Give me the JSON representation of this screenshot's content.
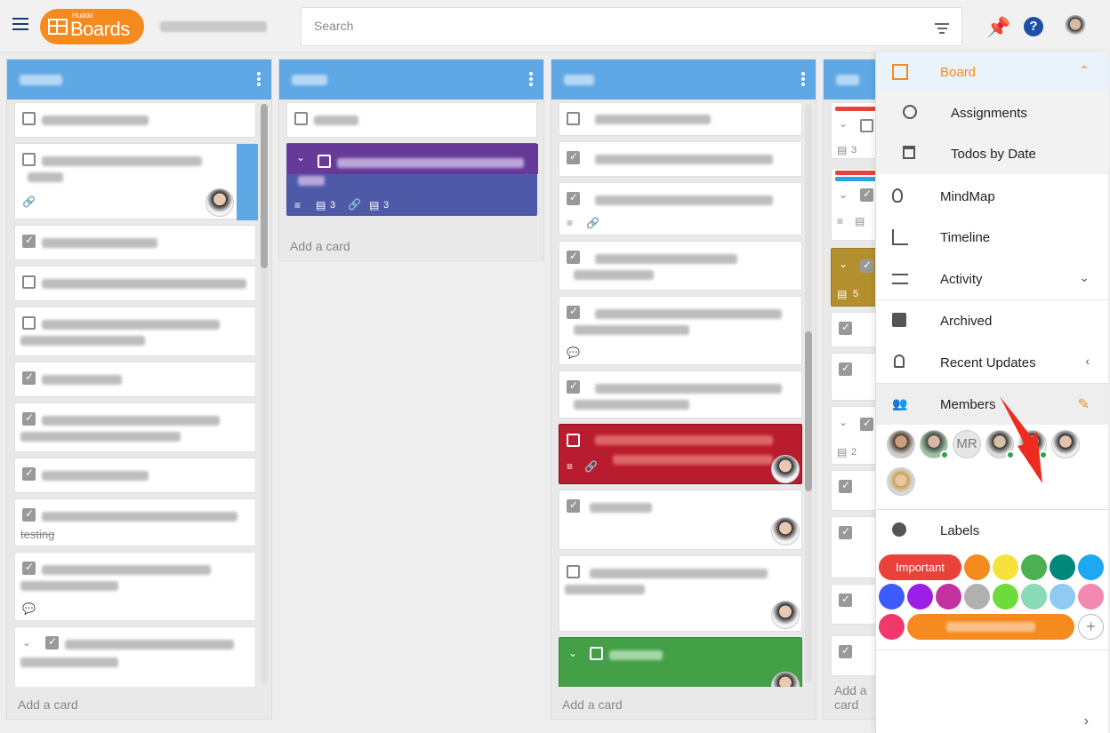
{
  "header": {
    "logo_small": "Huddo",
    "logo_text": "Boards",
    "search_placeholder": "Search"
  },
  "columns": [
    {
      "add_card": "Add a card",
      "card_extra_text": "testing"
    },
    {
      "add_card": "Add a card",
      "card_counts": [
        "3",
        "3"
      ]
    },
    {
      "add_card": "Add a card"
    },
    {
      "add_card": "Add a card",
      "card_counts": [
        "3",
        "5",
        "2"
      ]
    }
  ],
  "panel": {
    "items": [
      {
        "label": "Board"
      },
      {
        "label": "Assignments"
      },
      {
        "label": "Todos by Date"
      },
      {
        "label": "MindMap"
      },
      {
        "label": "Timeline"
      },
      {
        "label": "Activity"
      },
      {
        "label": "Archived"
      },
      {
        "label": "Recent Updates"
      },
      {
        "label": "Members"
      },
      {
        "label": "Labels"
      }
    ],
    "member_initials": "MR",
    "important_label": "Important"
  },
  "colors": {
    "accent_orange": "#f58a1f",
    "column_header": "#5fa8e6",
    "label_red": "#e8423b",
    "online_green": "#2ba84a"
  }
}
